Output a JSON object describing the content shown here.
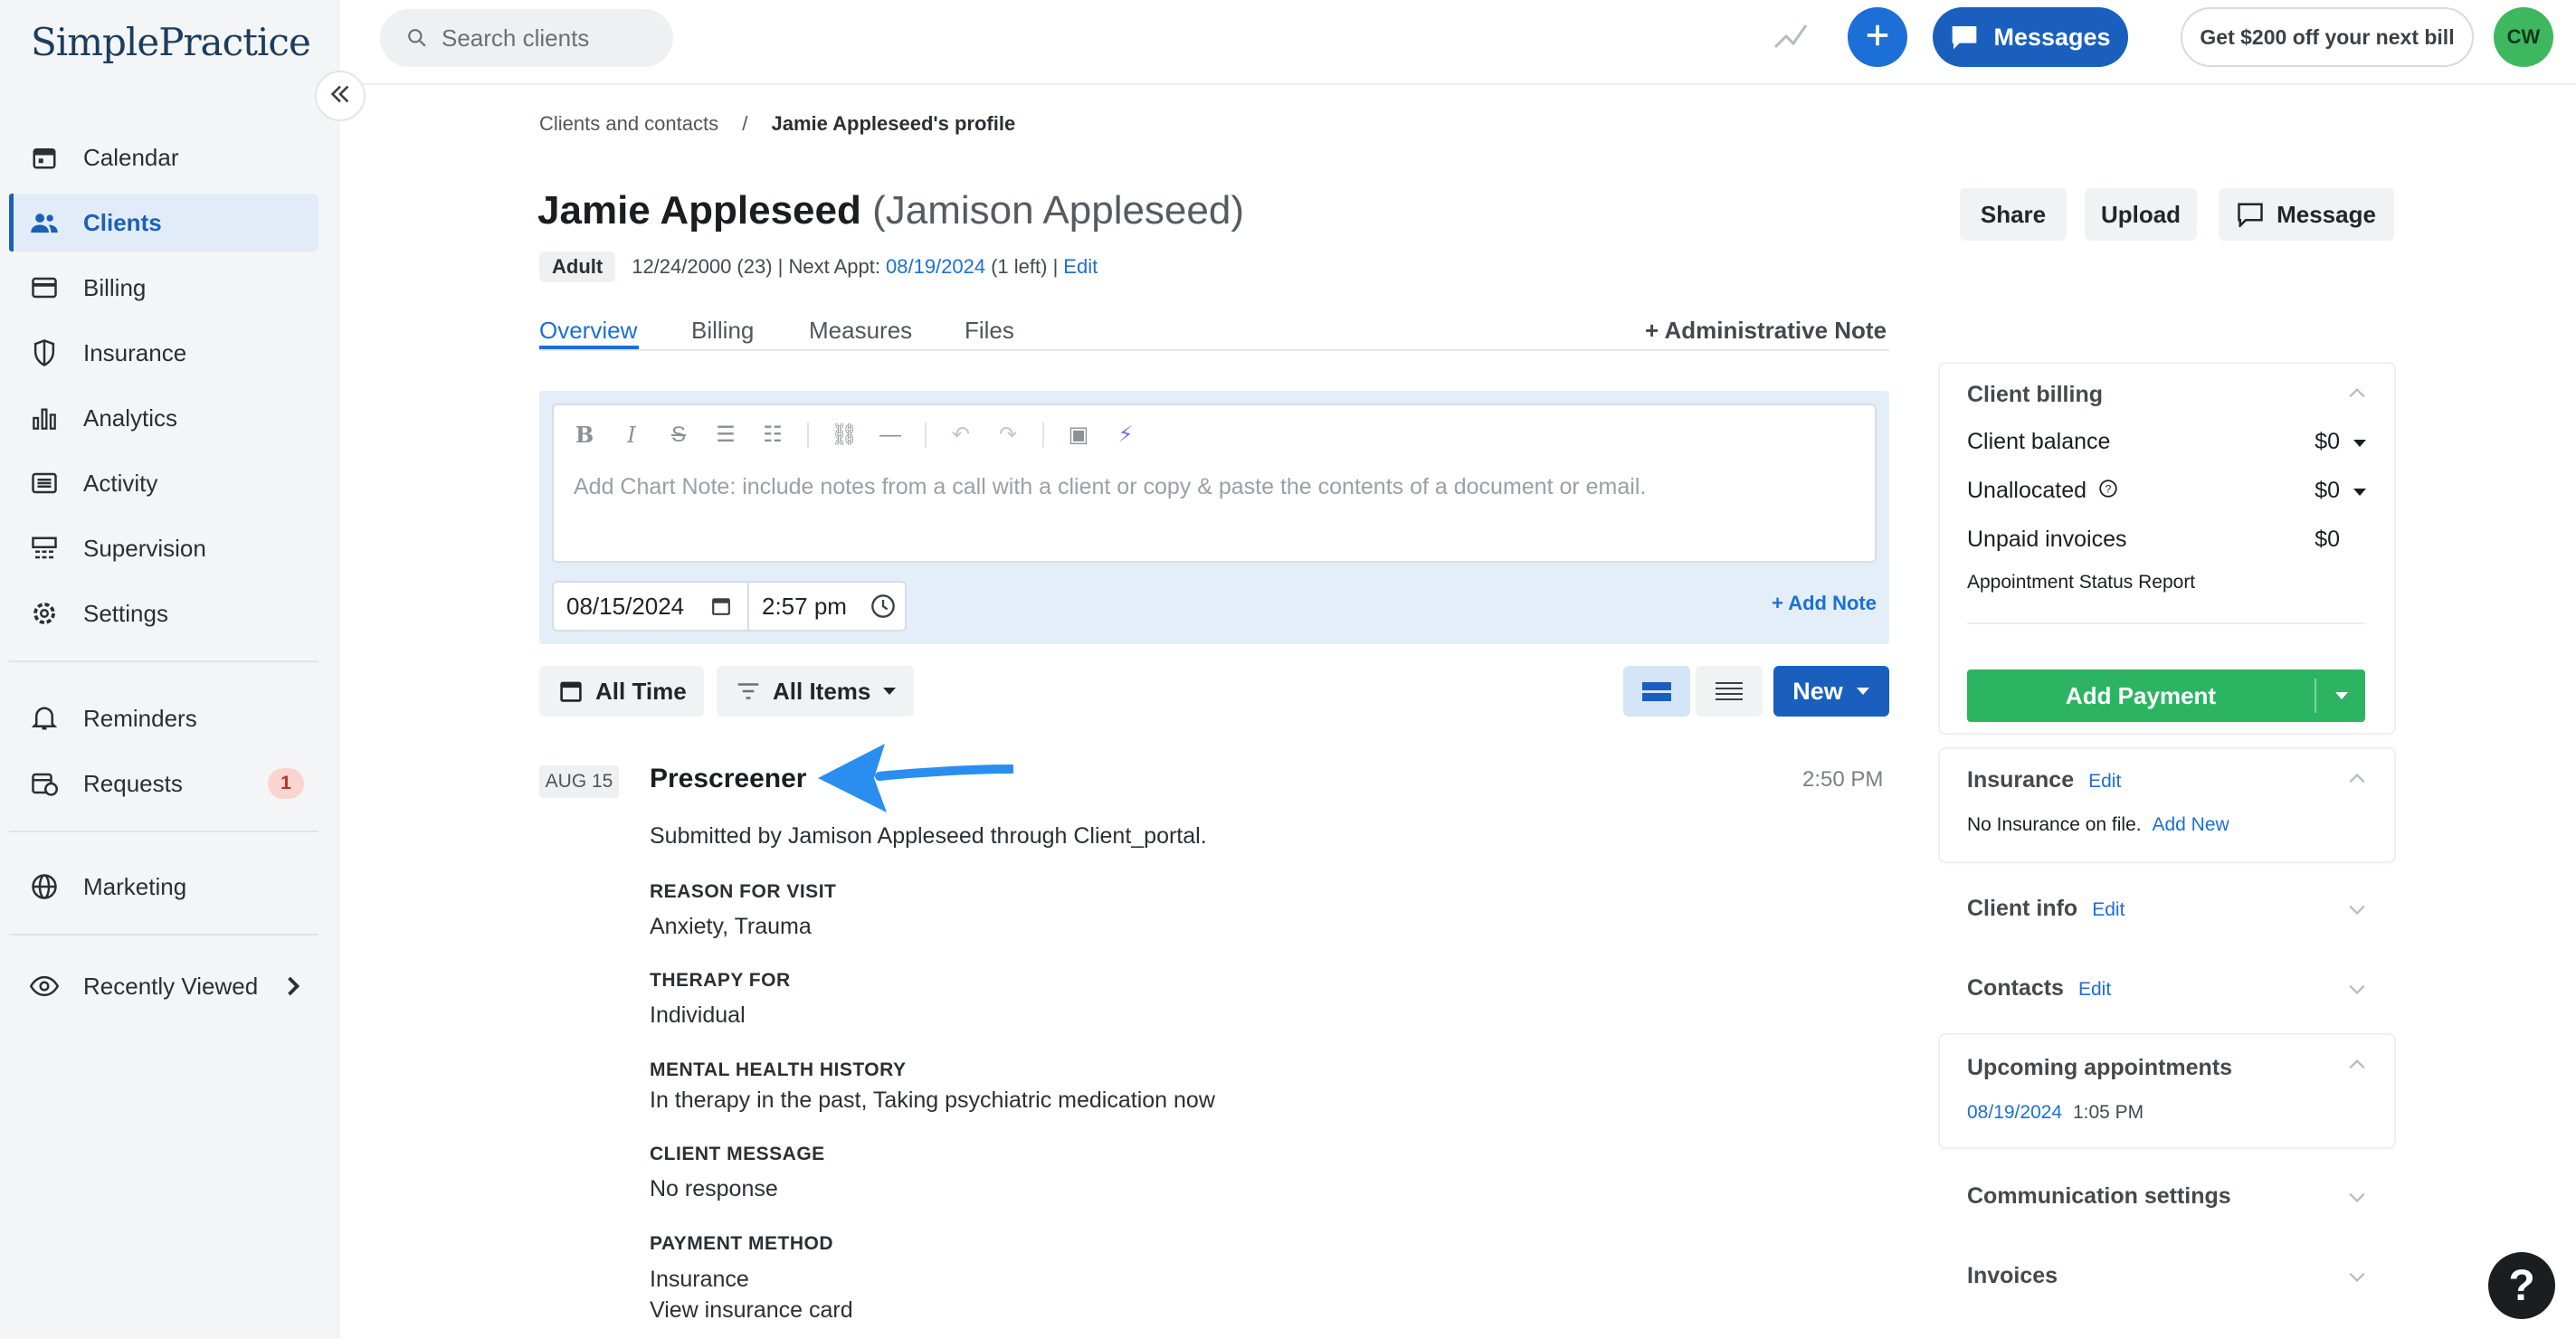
{
  "app": {
    "logo": "SimplePractice"
  },
  "sidebar": {
    "items": [
      {
        "label": "Calendar",
        "icon": "calendar-icon"
      },
      {
        "label": "Clients",
        "icon": "clients-icon",
        "active": true
      },
      {
        "label": "Billing",
        "icon": "billing-icon"
      },
      {
        "label": "Insurance",
        "icon": "shield-icon"
      },
      {
        "label": "Analytics",
        "icon": "analytics-icon"
      },
      {
        "label": "Activity",
        "icon": "activity-icon"
      },
      {
        "label": "Supervision",
        "icon": "supervision-icon"
      },
      {
        "label": "Settings",
        "icon": "gear-icon"
      },
      {
        "label": "Reminders",
        "icon": "bell-icon"
      },
      {
        "label": "Requests",
        "icon": "requests-icon",
        "badge": "1"
      },
      {
        "label": "Marketing",
        "icon": "globe-icon"
      },
      {
        "label": "Recently Viewed",
        "icon": "eye-icon"
      }
    ]
  },
  "topbar": {
    "search_placeholder": "Search clients",
    "messages_label": "Messages",
    "promo_label": "Get $200 off your next bill",
    "avatar_initials": "CW"
  },
  "breadcrumb": {
    "parent": "Clients and contacts",
    "separator": "/",
    "current": "Jamie Appleseed's profile"
  },
  "client": {
    "name": "Jamie Appleseed",
    "alt_name": "(Jamison Appleseed)",
    "tag": "Adult",
    "dob": "12/24/2000 (23) | Next Appt:",
    "next_appt": "08/19/2024",
    "left": "(1 left) |",
    "edit": "Edit"
  },
  "header_buttons": {
    "share": "Share",
    "upload": "Upload",
    "message": "Message"
  },
  "tabs": [
    {
      "label": "Overview",
      "active": true
    },
    {
      "label": "Billing"
    },
    {
      "label": "Measures"
    },
    {
      "label": "Files"
    }
  ],
  "admin_note_label": "+ Administrative Note",
  "editor": {
    "placeholder": "Add Chart Note: include notes from a call with a client or copy & paste the contents of a document or email.",
    "date": "08/15/2024",
    "time": "2:57 pm",
    "add_note": "+ Add Note"
  },
  "filters": {
    "time": "All Time",
    "items": "All Items",
    "new": "New"
  },
  "entry": {
    "date_tag": "AUG 15",
    "title": "Prescreener",
    "time": "2:50 PM",
    "submitted": "Submitted by Jamison Appleseed through Client_portal.",
    "fields": [
      {
        "label": "REASON FOR VISIT",
        "value": "Anxiety, Trauma"
      },
      {
        "label": "THERAPY FOR",
        "value": "Individual"
      },
      {
        "label": "MENTAL HEALTH HISTORY",
        "value": "In therapy in the past, Taking psychiatric medication now"
      },
      {
        "label": "CLIENT MESSAGE",
        "value": "No response"
      },
      {
        "label": "PAYMENT METHOD",
        "value": "Insurance"
      }
    ],
    "insurance_link": "View insurance card"
  },
  "billing_panel": {
    "title": "Client billing",
    "balance_label": "Client balance",
    "balance_value": "$0",
    "unallocated_label": "Unallocated",
    "unallocated_value": "$0",
    "unpaid_label": "Unpaid invoices",
    "unpaid_value": "$0",
    "report_link": "Appointment Status Report",
    "add_payment": "Add Payment"
  },
  "insurance_panel": {
    "title": "Insurance",
    "edit": "Edit",
    "text": "No Insurance on file.",
    "add_new": "Add New"
  },
  "client_info": {
    "title": "Client info",
    "edit": "Edit"
  },
  "contacts": {
    "title": "Contacts",
    "edit": "Edit"
  },
  "upcoming": {
    "title": "Upcoming appointments",
    "date": "08/19/2024",
    "time": "1:05 PM"
  },
  "communication": {
    "title": "Communication settings"
  },
  "invoices": {
    "title": "Invoices"
  },
  "help_label": "?",
  "colors": {
    "accent": "#1c6fd6",
    "primary": "#1a5fbd",
    "success": "#2cb463",
    "arrow": "#2a8ef0"
  }
}
